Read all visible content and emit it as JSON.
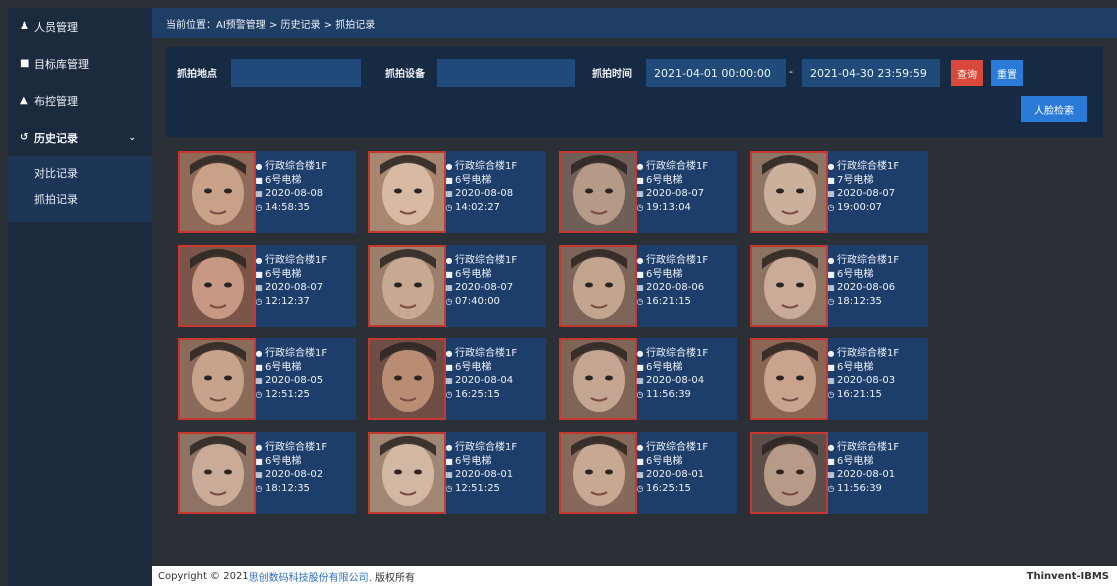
{
  "sidebar": {
    "items": [
      {
        "label": "人员管理",
        "icon": "person-icon"
      },
      {
        "label": "目标库管理",
        "icon": "folder-icon"
      },
      {
        "label": "布控管理",
        "icon": "lock-icon"
      },
      {
        "label": "历史记录",
        "icon": "history-icon",
        "expanded": true
      }
    ],
    "subitems": [
      {
        "label": "对比记录"
      },
      {
        "label": "抓拍记录"
      }
    ]
  },
  "breadcrumb": "当前位置：AI预警管理 > 历史记录 > 抓拍记录",
  "filter": {
    "location_label": "抓拍地点",
    "location_value": "",
    "device_label": "抓拍设备",
    "device_value": "",
    "time_label": "抓拍时间",
    "start_time": "2021-04-01 00:00:00",
    "dash": "-",
    "end_time": "2021-04-30 23:59:59",
    "query_button": "查询",
    "reset_button": "重置",
    "face_search_button": "人脸检索"
  },
  "records": [
    {
      "location": "行政综合楼1F",
      "device": "6号电梯",
      "date": "2020-08-08",
      "time": "14:58:35"
    },
    {
      "location": "行政综合楼1F",
      "device": "6号电梯",
      "date": "2020-08-08",
      "time": "14:02:27"
    },
    {
      "location": "行政综合楼1F",
      "device": "6号电梯",
      "date": "2020-08-07",
      "time": "19:13:04"
    },
    {
      "location": "行政综合楼1F",
      "device": "7号电梯",
      "date": "2020-08-07",
      "time": "19:00:07"
    },
    {
      "location": "行政综合楼1F",
      "device": "6号电梯",
      "date": "2020-08-07",
      "time": "12:12:37"
    },
    {
      "location": "行政综合楼1F",
      "device": "6号电梯",
      "date": "2020-08-07",
      "time": "07:40:00"
    },
    {
      "location": "行政综合楼1F",
      "device": "6号电梯",
      "date": "2020-08-06",
      "time": "16:21:15"
    },
    {
      "location": "行政综合楼1F",
      "device": "6号电梯",
      "date": "2020-08-06",
      "time": "18:12:35"
    },
    {
      "location": "行政综合楼1F",
      "device": "6号电梯",
      "date": "2020-08-05",
      "time": "12:51:25"
    },
    {
      "location": "行政综合楼1F",
      "device": "6号电梯",
      "date": "2020-08-04",
      "time": "16:25:15"
    },
    {
      "location": "行政综合楼1F",
      "device": "6号电梯",
      "date": "2020-08-04",
      "time": "11:56:39"
    },
    {
      "location": "行政综合楼1F",
      "device": "6号电梯",
      "date": "2020-08-03",
      "time": "16:21:15"
    },
    {
      "location": "行政综合楼1F",
      "device": "6号电梯",
      "date": "2020-08-02",
      "time": "18:12:35"
    },
    {
      "location": "行政综合楼1F",
      "device": "6号电梯",
      "date": "2020-08-01",
      "time": "12:51:25"
    },
    {
      "location": "行政综合楼1F",
      "device": "6号电梯",
      "date": "2020-08-01",
      "time": "16:25:15"
    },
    {
      "location": "行政综合楼1F",
      "device": "6号电梯",
      "date": "2020-08-01",
      "time": "11:56:39"
    }
  ],
  "footer": {
    "copyright_prefix": "Copyright © 2021 ",
    "company": "思创数码科技股份有限公司",
    "rights": ". 版权所有",
    "brand": "Thinvent-IBMS"
  },
  "colors": {
    "sidebar": "#1c2a3e",
    "topbar": "#1f3e66",
    "card": "#1d3d6b",
    "query": "#d9483b",
    "accent_blue": "#2a7bd8",
    "photo_border": "#c6372f"
  }
}
